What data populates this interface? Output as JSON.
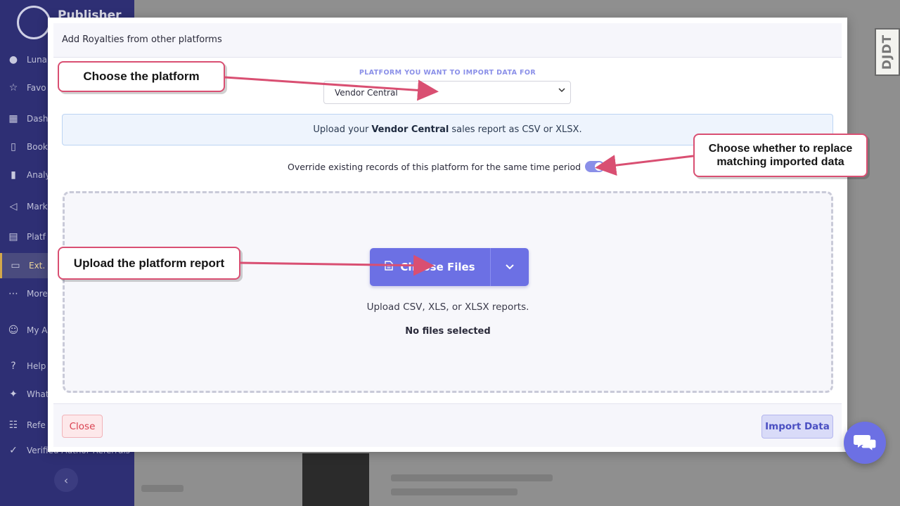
{
  "sidebar": {
    "brand": "Publisher",
    "items": [
      {
        "label": "Luna",
        "icon": "avatar-icon"
      },
      {
        "label": "Favo",
        "icon": "star-icon"
      },
      {
        "label": "Dash",
        "icon": "dashboard-icon"
      },
      {
        "label": "Book",
        "icon": "book-icon"
      },
      {
        "label": "Analy",
        "icon": "analytics-icon"
      },
      {
        "label": "Mark",
        "icon": "megaphone-icon"
      },
      {
        "label": "Platf",
        "icon": "platform-icon"
      },
      {
        "label": "Ext.",
        "icon": "wallet-icon"
      },
      {
        "label": "More",
        "icon": "more-icon"
      },
      {
        "label": "My A",
        "icon": "user-gear-icon"
      },
      {
        "label": "Help",
        "icon": "help-icon"
      },
      {
        "label": "What",
        "icon": "sparkle-icon"
      },
      {
        "label": "Refe",
        "icon": "users-icon"
      },
      {
        "label": "Verified Author Referrals",
        "icon": "check-circle-icon"
      }
    ]
  },
  "modal": {
    "title": "Add Royalties from other platforms",
    "platform_label": "PLATFORM YOU WANT TO IMPORT DATA FOR",
    "platform_value": "Vendor Central",
    "info": {
      "prefix": "Upload your",
      "platform": "Vendor Central",
      "suffix": "sales report as CSV or XLSX."
    },
    "override_label": "Override existing records of this platform for the same time period",
    "override_enabled": true,
    "dropzone": {
      "button_label": "Choose Files",
      "hint": "Upload CSV, XLS, or XLSX reports.",
      "status": "No files selected"
    },
    "close_label": "Close",
    "import_label": "Import Data"
  },
  "annotations": {
    "choose_platform": "Choose the platform",
    "replace": "Choose whether to replace matching imported data",
    "upload": "Upload the platform report"
  },
  "watermark": "DJDT",
  "colors": {
    "accent": "#6c70e4",
    "callout_border": "#d94f72",
    "sidebar_bg": "#2e2f74",
    "close_red": "#d9404f"
  }
}
